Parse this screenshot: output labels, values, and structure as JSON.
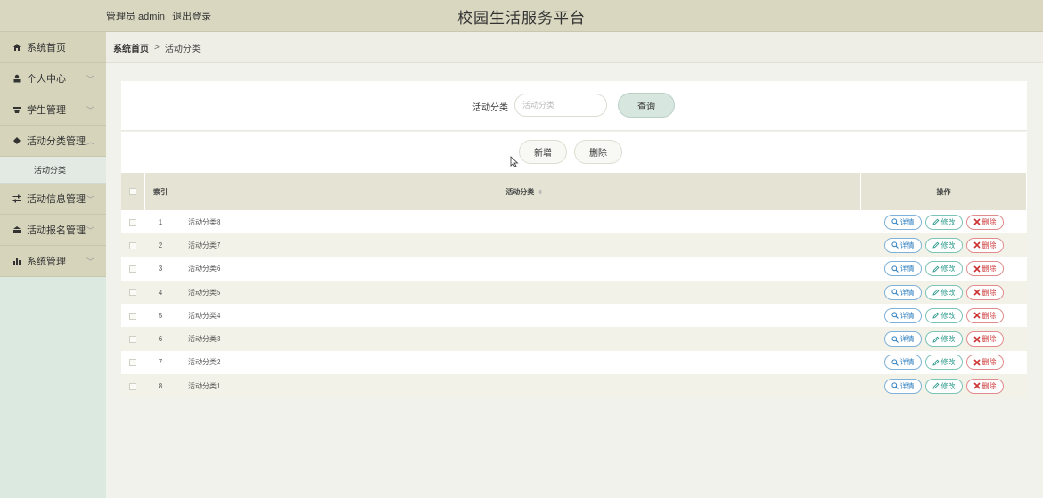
{
  "header": {
    "admin_label": "管理员 admin",
    "logout_label": "退出登录",
    "site_title": "校园生活服务平台"
  },
  "sidebar": {
    "items": [
      {
        "label": "系统首页",
        "icon": "home-icon"
      },
      {
        "label": "个人中心",
        "icon": "user-icon"
      },
      {
        "label": "学生管理",
        "icon": "student-icon"
      },
      {
        "label": "活动分类管理",
        "icon": "category-icon"
      },
      {
        "label": "活动信息管理",
        "icon": "sliders-icon"
      },
      {
        "label": "活动报名管理",
        "icon": "signup-icon"
      },
      {
        "label": "系统管理",
        "icon": "bar-chart-icon"
      }
    ],
    "sub_item": "活动分类"
  },
  "breadcrumb": {
    "home": "系统首页",
    "separator": ">",
    "current": "活动分类"
  },
  "search": {
    "label": "活动分类",
    "placeholder": "活动分类",
    "button": "查询"
  },
  "actions": {
    "add": "新增",
    "delete": "删除"
  },
  "table": {
    "headers": {
      "index": "索引",
      "name": "活动分类",
      "ops": "操作"
    },
    "rows": [
      {
        "index": "1",
        "name": "活动分类8"
      },
      {
        "index": "2",
        "name": "活动分类7"
      },
      {
        "index": "3",
        "name": "活动分类6"
      },
      {
        "index": "4",
        "name": "活动分类5"
      },
      {
        "index": "5",
        "name": "活动分类4"
      },
      {
        "index": "6",
        "name": "活动分类3"
      },
      {
        "index": "7",
        "name": "活动分类2"
      },
      {
        "index": "8",
        "name": "活动分类1"
      }
    ],
    "op_labels": {
      "detail": "详情",
      "edit": "修改",
      "delete": "删除"
    }
  },
  "colors": {
    "header_bg": "#d9d7c0",
    "sidebar_item_bg": "#d6d4bb",
    "table_head_bg": "#e4e3d4",
    "detail": "#2f7fc0",
    "edit": "#2c9a8b",
    "delete": "#cc3333"
  }
}
